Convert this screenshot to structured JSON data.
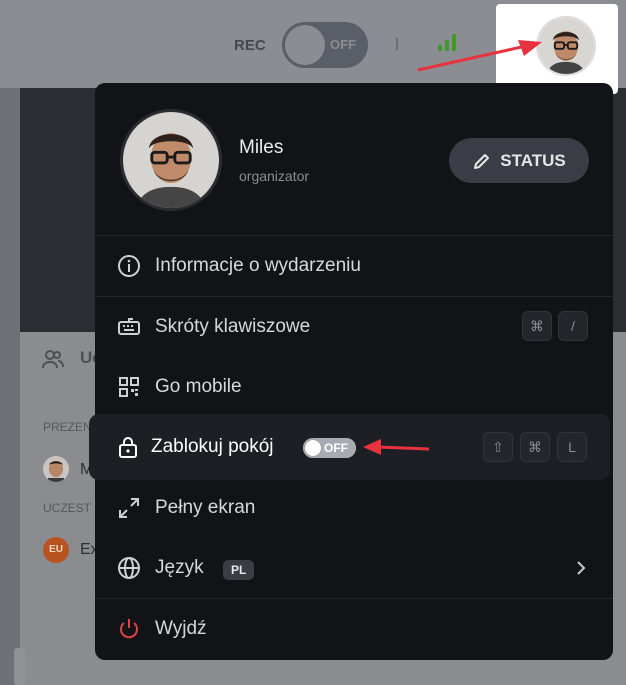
{
  "topbar": {
    "rec_label": "REC",
    "rec_toggle_text": "OFF"
  },
  "background": {
    "tab_label": "Uc",
    "section_presenters": "PREZEN",
    "presenter_initial": "M",
    "section_participants": "UCZEST",
    "participant_badge": "EU",
    "participant_initial": "Ex"
  },
  "profile": {
    "name": "Miles",
    "role": "organizator",
    "status_button": "STATUS"
  },
  "menu": {
    "event_info": "Informacje o wydarzeniu",
    "shortcuts": "Skróty klawiszowe",
    "shortcuts_keys": [
      "⌘",
      "/"
    ],
    "go_mobile": "Go mobile",
    "lock_room": "Zablokuj pokój",
    "lock_toggle_text": "OFF",
    "lock_keys": [
      "⇧",
      "⌘",
      "L"
    ],
    "fullscreen": "Pełny ekran",
    "language": "Język",
    "language_badge": "PL",
    "logout": "Wyjdź"
  },
  "colors": {
    "menu_bg": "#121317",
    "highlight_row": "#1d1f25",
    "annotation_arrow": "#e8323f",
    "power_icon": "#e0424a",
    "signal_green": "#3f9a2a"
  }
}
